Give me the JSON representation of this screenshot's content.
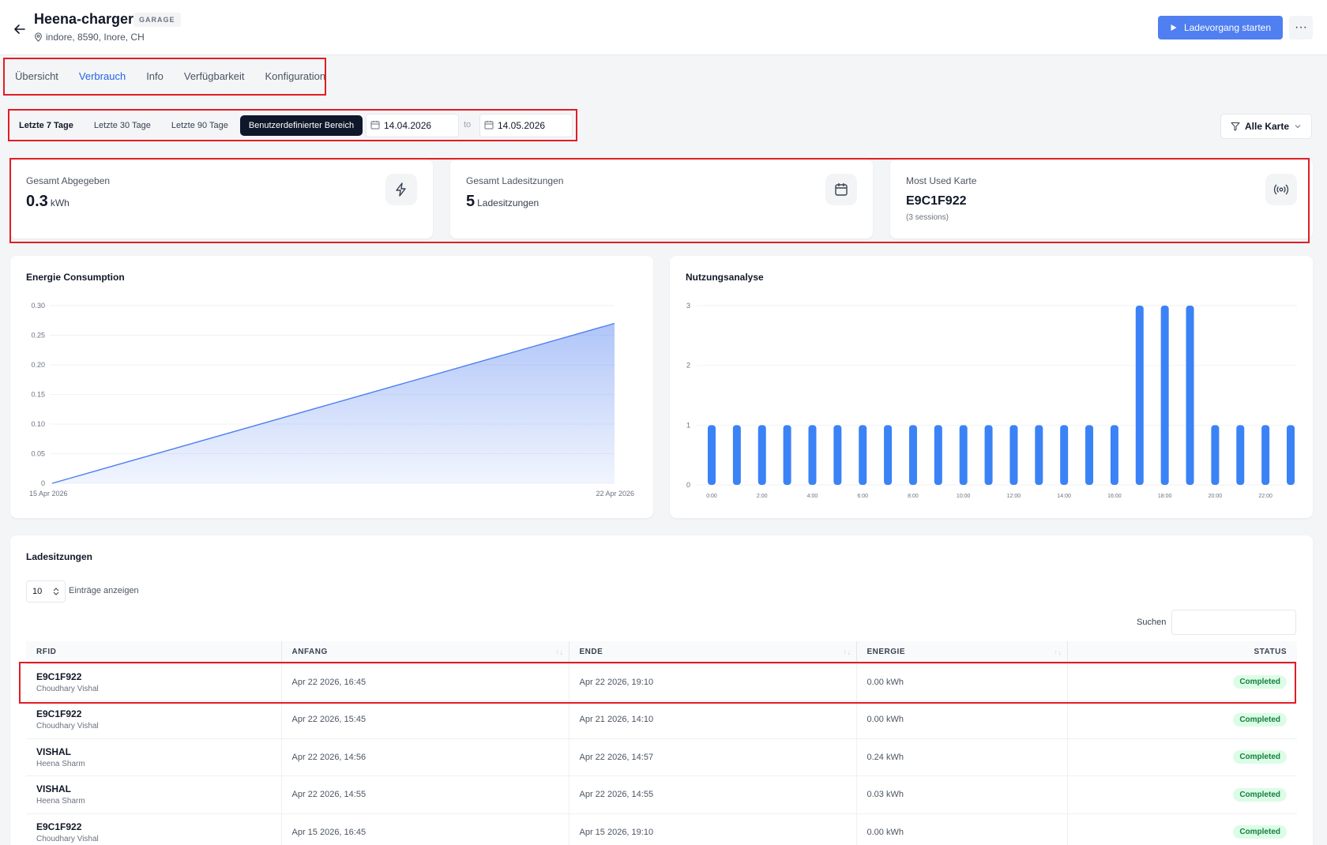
{
  "header": {
    "title": "Heena-charger",
    "badge": "GARAGE",
    "location": "indore, 8590, Inore, CH",
    "start_button": "Ladevorgang starten",
    "more_button": "···"
  },
  "tabs": [
    {
      "label": "Übersicht",
      "active": false
    },
    {
      "label": "Verbrauch",
      "active": true
    },
    {
      "label": "Info",
      "active": false
    },
    {
      "label": "Verfügbarkeit",
      "active": false
    },
    {
      "label": "Konfiguration",
      "active": false
    }
  ],
  "ranges": [
    {
      "label": "Letzte 7 Tage"
    },
    {
      "label": "Letzte 30 Tage"
    },
    {
      "label": "Letzte 90 Tage"
    },
    {
      "label": "Benutzerdefinierter Bereich"
    }
  ],
  "date_from": "14.04.2026",
  "date_to": "14.05.2026",
  "to_label": "to",
  "filter_label": "Alle Karte",
  "stats": {
    "delivered": {
      "label": "Gesamt Abgegeben",
      "value": "0.3",
      "unit": "kWh"
    },
    "sessions": {
      "label": "Gesamt Ladesitzungen",
      "value": "5",
      "unit": "Ladesitzungen"
    },
    "card": {
      "label": "Most Used Karte",
      "value": "E9C1F922",
      "sub": "(3 sessions)"
    }
  },
  "energy_chart_title": "Energie Consumption",
  "usage_chart_title": "Nutzungsanalyse",
  "chart_data": [
    {
      "type": "area",
      "title": "Energie Consumption",
      "x": [
        "15 Apr 2026",
        "22 Apr 2026"
      ],
      "y": [
        0,
        0.27
      ],
      "ylim": [
        0,
        0.3
      ],
      "yticks": [
        "0",
        "0.05",
        "0.10",
        "0.15",
        "0.20",
        "0.25",
        "0.30"
      ],
      "grid": true,
      "color": "#4f7ff0"
    },
    {
      "type": "bar",
      "title": "Nutzungsanalyse",
      "categories": [
        "0:00",
        "1:00",
        "2:00",
        "3:00",
        "4:00",
        "5:00",
        "6:00",
        "7:00",
        "8:00",
        "9:00",
        "10:00",
        "11:00",
        "12:00",
        "13:00",
        "14:00",
        "15:00",
        "16:00",
        "17:00",
        "18:00",
        "19:00",
        "20:00",
        "21:00",
        "22:00",
        "23:00"
      ],
      "xticks": [
        "0:00",
        "2:00",
        "4:00",
        "6:00",
        "8:00",
        "10:00",
        "12:00",
        "14:00",
        "16:00",
        "18:00",
        "20:00",
        "22:00"
      ],
      "values": [
        1,
        1,
        1,
        1,
        1,
        1,
        1,
        1,
        1,
        1,
        1,
        1,
        1,
        1,
        1,
        1,
        1,
        3,
        3,
        3,
        1,
        1,
        1,
        1
      ],
      "ylim": [
        0,
        3
      ],
      "yticks": [
        "0",
        "1",
        "2",
        "3"
      ],
      "grid": true,
      "color": "#3b82f6"
    }
  ],
  "sessions_section": {
    "title": "Ladesitzungen",
    "per_page": "10",
    "per_page_label": "Einträge anzeigen",
    "search_label": "Suchen",
    "columns": [
      "RFID",
      "ANFANG",
      "ENDE",
      "ENERGIE",
      "STATUS"
    ],
    "rows": [
      {
        "rfid": "E9C1F922",
        "user": "Choudhary Vishal",
        "start": "Apr 22 2026, 16:45",
        "end": "Apr 22 2026, 19:10",
        "energy": "0.00 kWh",
        "status": "Completed"
      },
      {
        "rfid": "E9C1F922",
        "user": "Choudhary Vishal",
        "start": "Apr 22 2026, 15:45",
        "end": "Apr 21 2026, 14:10",
        "energy": "0.00 kWh",
        "status": "Completed"
      },
      {
        "rfid": "VISHAL",
        "user": "Heena Sharm",
        "start": "Apr 22 2026, 14:56",
        "end": "Apr 22 2026, 14:57",
        "energy": "0.24 kWh",
        "status": "Completed"
      },
      {
        "rfid": "VISHAL",
        "user": "Heena Sharm",
        "start": "Apr 22 2026, 14:55",
        "end": "Apr 22 2026, 14:55",
        "energy": "0.03 kWh",
        "status": "Completed"
      },
      {
        "rfid": "E9C1F922",
        "user": "Choudhary Vishal",
        "start": "Apr 15 2026, 16:45",
        "end": "Apr 15 2026, 19:10",
        "energy": "0.00 kWh",
        "status": "Completed"
      }
    ]
  }
}
